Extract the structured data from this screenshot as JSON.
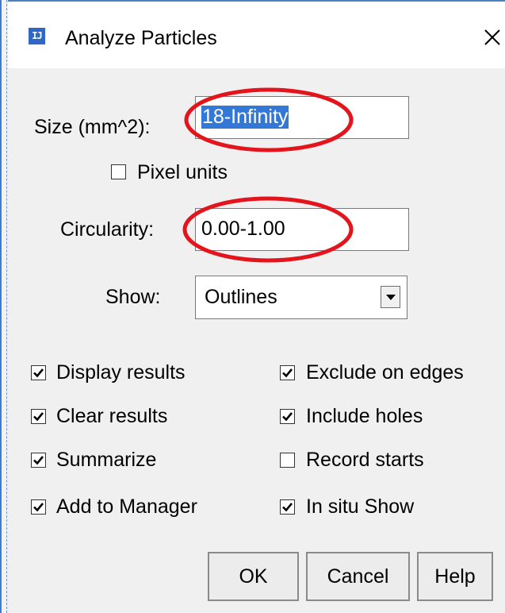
{
  "window": {
    "title": "Analyze Particles",
    "app_icon_glyph": "IJ",
    "close_glyph": "✕"
  },
  "size": {
    "label": "Size (mm^2):",
    "value": "18-Infinity"
  },
  "pixel_units": {
    "label": "Pixel units",
    "checked": false
  },
  "circularity": {
    "label": "Circularity:",
    "value": "0.00-1.00"
  },
  "show": {
    "label": "Show:",
    "value": "Outlines"
  },
  "options_left": [
    {
      "label": "Display results",
      "checked": true
    },
    {
      "label": "Clear results",
      "checked": true
    },
    {
      "label": "Summarize",
      "checked": true
    },
    {
      "label": "Add to Manager",
      "checked": true
    }
  ],
  "options_right": [
    {
      "label": "Exclude on edges",
      "checked": true
    },
    {
      "label": "Include holes",
      "checked": true
    },
    {
      "label": "Record starts",
      "checked": false
    },
    {
      "label": "In situ Show",
      "checked": true
    }
  ],
  "buttons": {
    "ok": "OK",
    "cancel": "Cancel",
    "help": "Help"
  },
  "annotation_color": "#e3141b",
  "selection_color": "#3378d6"
}
